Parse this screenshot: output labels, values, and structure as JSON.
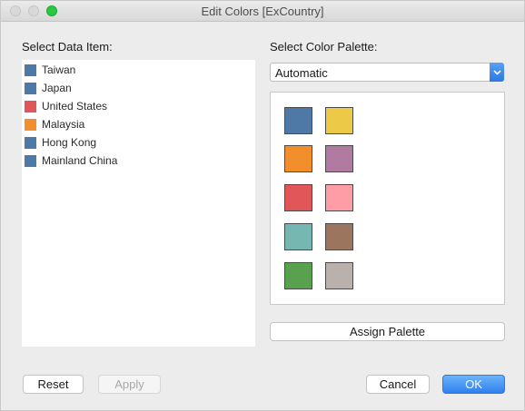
{
  "window": {
    "title": "Edit Colors [ExCountry]"
  },
  "left": {
    "label": "Select Data Item:",
    "items": [
      {
        "label": "Taiwan",
        "color": "#4e79a7"
      },
      {
        "label": "Japan",
        "color": "#4e79a7"
      },
      {
        "label": "United States",
        "color": "#e15759"
      },
      {
        "label": "Malaysia",
        "color": "#f28e2b"
      },
      {
        "label": "Hong Kong",
        "color": "#4e79a7"
      },
      {
        "label": "Mainland China",
        "color": "#4e79a7"
      }
    ]
  },
  "right": {
    "label": "Select Color Palette:",
    "palette_select": {
      "value": "Automatic"
    },
    "palette_colors": [
      "#4e79a7",
      "#edc948",
      "#f28e2b",
      "#b07aa1",
      "#e15759",
      "#ff9da7",
      "#76b7b2",
      "#9c755f",
      "#59a14f",
      "#bab0ac"
    ],
    "assign_label": "Assign Palette"
  },
  "footer": {
    "reset_label": "Reset",
    "apply_label": "Apply",
    "cancel_label": "Cancel",
    "ok_label": "OK"
  },
  "icons": {
    "dropdown": "chevron-down-icon"
  }
}
